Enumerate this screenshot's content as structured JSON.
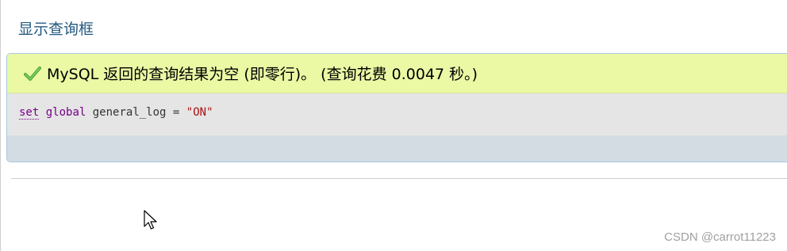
{
  "toggle_query_box": "显示查询框",
  "message": {
    "icon": "check-icon",
    "text": "MySQL 返回的查询结果为空 (即零行)。 (查询花费 0.0047 秒。)"
  },
  "sql": {
    "set": "set",
    "global": "global",
    "variable": "general_log",
    "operator": "=",
    "value": "\"ON\""
  },
  "watermark": "CSDN @carrot11223",
  "colors": {
    "link": "#235a81",
    "success_bg": "#ebf8a4",
    "sql_bg": "#e5e5e5",
    "tools_bg": "#d3dce3",
    "keyword": "#770088",
    "string": "#aa1111"
  }
}
